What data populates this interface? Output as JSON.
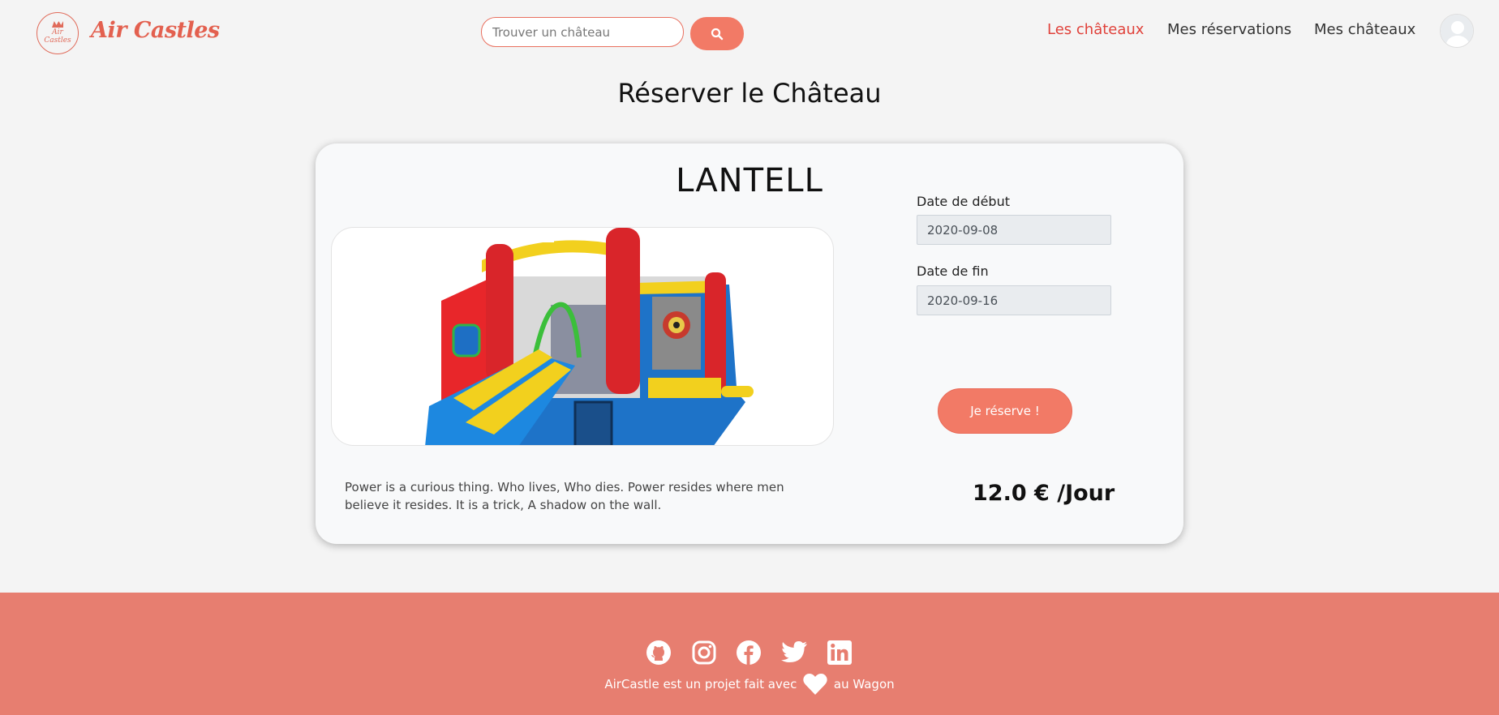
{
  "brand": {
    "name": "Air Castles",
    "badge_line1": "Air",
    "badge_line2": "Castles",
    "color": "#e3604f"
  },
  "search": {
    "placeholder": "Trouver un château",
    "icon": "search-icon"
  },
  "nav": {
    "links": [
      "Les châteaux",
      "Mes réservations",
      "Mes châteaux"
    ],
    "active": "Les châteaux",
    "active_color": "#e0413a"
  },
  "page": {
    "title": "Réserver le Château"
  },
  "castle": {
    "name": "LANTELL",
    "description": "Power is a curious thing. Who lives, Who dies. Power resides where men believe it resides. It is a trick, A shadow on the wall.",
    "price": "12.0 € /Jour"
  },
  "form": {
    "start_label": "Date de début",
    "start_value": "2020-09-08",
    "end_label": "Date de fin",
    "end_value": "2020-09-16",
    "submit_label": "Je réserve !",
    "accent": "#f27a66"
  },
  "footer": {
    "icons": [
      "github-icon",
      "instagram-icon",
      "facebook-icon",
      "twitter-icon",
      "linkedin-icon"
    ],
    "text_before": "AirCastle est un projet fait avec",
    "text_after": "au Wagon",
    "background": "#e77e70"
  }
}
